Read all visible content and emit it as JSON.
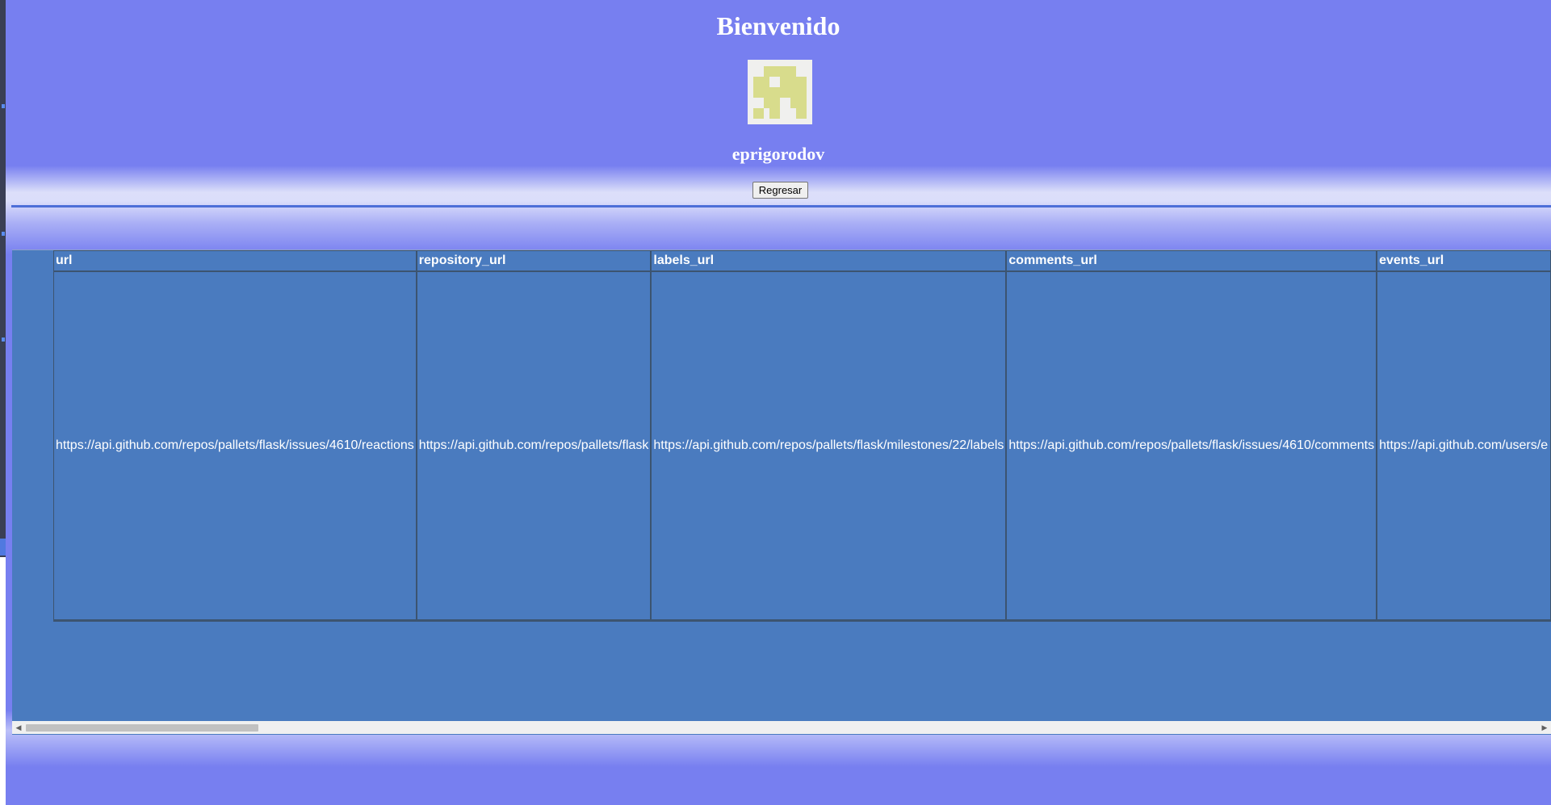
{
  "header": {
    "title": "Bienvenido",
    "username": "eprigorodov",
    "back_label": "Regresar"
  },
  "avatar": {
    "icon": "identicon-icon",
    "fg_color": "#d8dc8c",
    "bg_color": "#f0f0ee"
  },
  "table": {
    "columns": [
      "url",
      "repository_url",
      "labels_url",
      "comments_url",
      "events_url"
    ],
    "rows": [
      [
        "https://api.github.com/repos/pallets/flask/issues/4610/reactions",
        "https://api.github.com/repos/pallets/flask",
        "https://api.github.com/repos/pallets/flask/milestones/22/labels",
        "https://api.github.com/repos/pallets/flask/issues/4610/comments",
        "https://api.github.com/users/e"
      ]
    ]
  },
  "colors": {
    "page_bg": "#777ff0",
    "table_bg": "#4a7bbf",
    "divider": "#4d6fd8"
  }
}
